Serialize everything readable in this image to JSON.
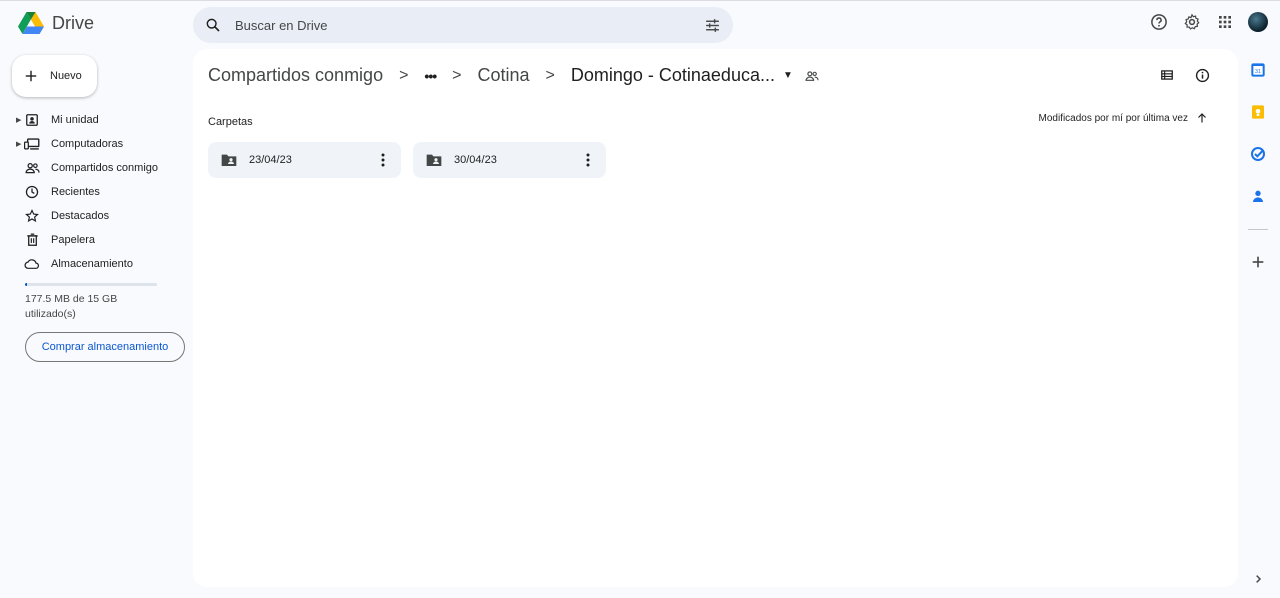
{
  "app": {
    "logo_text": "Drive"
  },
  "search": {
    "placeholder": "Buscar en Drive"
  },
  "header": {
    "icons": [
      "help-icon",
      "settings-icon",
      "apps-icon",
      "avatar"
    ]
  },
  "new_button": {
    "label": "Nuevo"
  },
  "nav": {
    "items": [
      {
        "label": "Mi unidad",
        "icon": "my-drive-icon",
        "expandable": true
      },
      {
        "label": "Computadoras",
        "icon": "computers-icon",
        "expandable": true
      },
      {
        "label": "Compartidos conmigo",
        "icon": "shared-icon",
        "expandable": false
      },
      {
        "label": "Recientes",
        "icon": "clock-icon",
        "expandable": false
      },
      {
        "label": "Destacados",
        "icon": "star-icon",
        "expandable": false
      },
      {
        "label": "Papelera",
        "icon": "trash-icon",
        "expandable": false
      },
      {
        "label": "Almacenamiento",
        "icon": "cloud-icon",
        "expandable": false
      }
    ]
  },
  "storage": {
    "used_text": "177.5 MB de 15 GB utilizado(s)",
    "used_fraction": 0.012,
    "buy_label": "Comprar almacenamiento"
  },
  "breadcrumb": {
    "root": "Compartidos conmigo",
    "ellipsis": "•••",
    "parent": "Cotina",
    "current": "Domingo - Cotinaeduca..."
  },
  "content": {
    "section_title": "Carpetas",
    "sort_label": "Modificados por mí por última vez",
    "folders": [
      {
        "name": "23/04/23"
      },
      {
        "name": "30/04/23"
      }
    ]
  },
  "side_panel": {
    "icons": [
      "calendar-icon",
      "keep-icon",
      "tasks-icon",
      "contacts-icon",
      "add-icon",
      "expand-icon"
    ]
  },
  "colors": {
    "accent": "#0b57d0",
    "background": "#f8fafd",
    "surface": "#ffffff",
    "folder_chip": "#f0f4f9"
  }
}
